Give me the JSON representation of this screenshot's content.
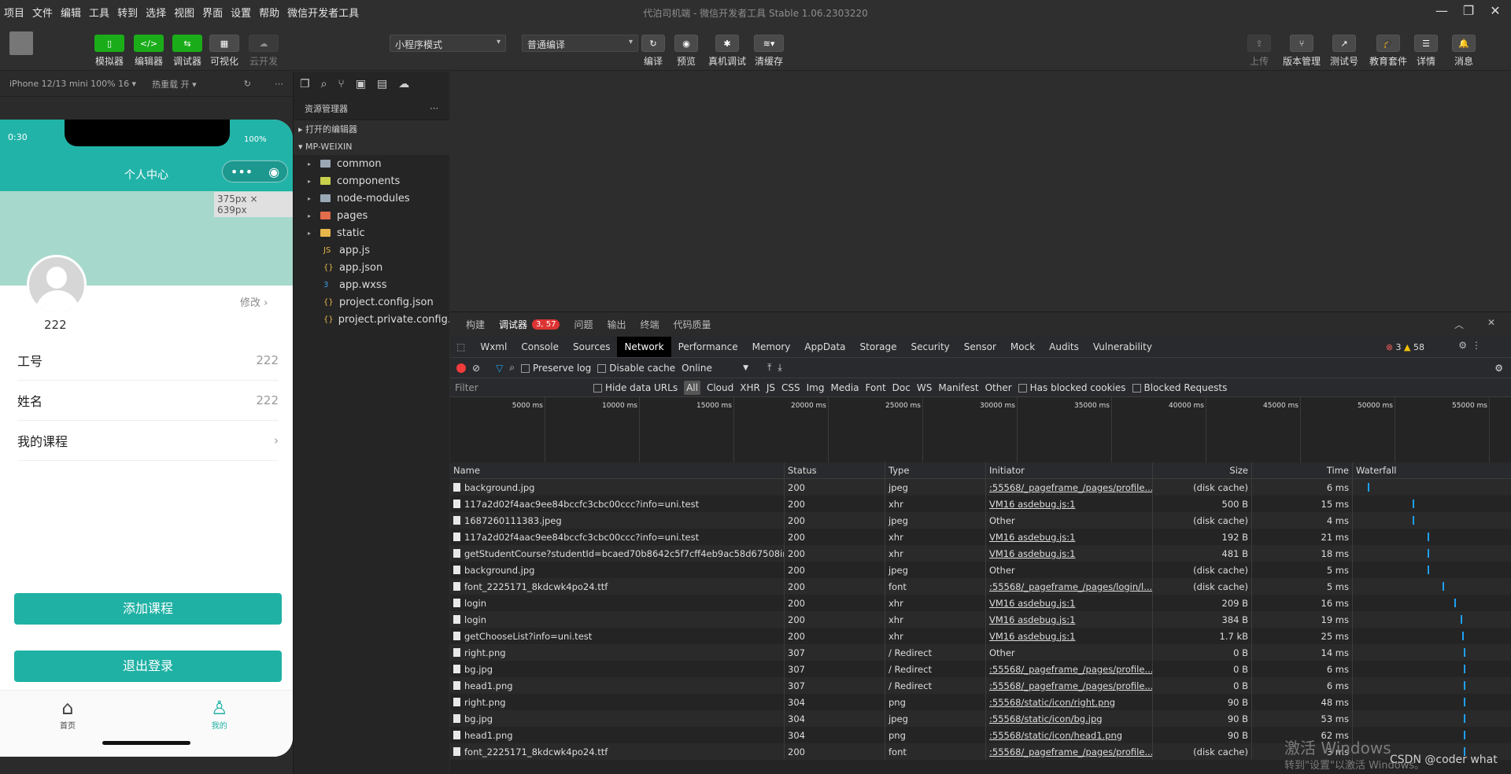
{
  "menu": [
    "项目",
    "文件",
    "编辑",
    "工具",
    "转到",
    "选择",
    "视图",
    "界面",
    "设置",
    "帮助",
    "微信开发者工具"
  ],
  "window_title": "代泊司机端 - 微信开发者工具 Stable 1.06.2303220",
  "toolbar": {
    "left": [
      "模拟器",
      "编辑器",
      "调试器",
      "可视化",
      "云开发"
    ],
    "mode": "小程序模式",
    "compile": "普通编译",
    "mid": [
      "编译",
      "预览",
      "真机调试",
      "清缓存"
    ],
    "right": [
      "上传",
      "版本管理",
      "测试号",
      "教育套件",
      "详情",
      "消息"
    ]
  },
  "sim": {
    "device": "iPhone 12/13 mini 100% 16 ▾",
    "hot": "热重载 开 ▾",
    "time": "0:30",
    "battery": "100%",
    "nav_title": "个人中心",
    "dim": "375px × 639px",
    "username": "222",
    "edit": "修改",
    "rows": [
      {
        "label": "工号",
        "value": "222"
      },
      {
        "label": "姓名",
        "value": "222"
      },
      {
        "label": "我的课程",
        "value": "›"
      }
    ],
    "btn_add": "添加课程",
    "btn_logout": "退出登录",
    "tab_home": "首页",
    "tab_me": "我的"
  },
  "explorer": {
    "title": "资源管理器",
    "open_editors": "打开的编辑器",
    "project": "MP-WEIXIN",
    "items": [
      {
        "name": "common",
        "type": "folder",
        "color": "#9aa7b5"
      },
      {
        "name": "components",
        "type": "folder",
        "color": "#c9d24a"
      },
      {
        "name": "node-modules",
        "type": "folder",
        "color": "#9aa7b5"
      },
      {
        "name": "pages",
        "type": "folder",
        "color": "#e26d4d"
      },
      {
        "name": "static",
        "type": "folder",
        "color": "#e8b74c"
      },
      {
        "name": "app.js",
        "type": "file",
        "icon": "JS"
      },
      {
        "name": "app.json",
        "type": "file",
        "icon": "{}"
      },
      {
        "name": "app.wxss",
        "type": "file",
        "icon": "3"
      },
      {
        "name": "project.config.json",
        "type": "file",
        "icon": "{}"
      },
      {
        "name": "project.private.config.js...",
        "type": "file",
        "icon": "{}"
      }
    ]
  },
  "devtools": {
    "tabs1": [
      "构建",
      "调试器",
      "问题",
      "输出",
      "终端",
      "代码质量"
    ],
    "badge": "3, 57",
    "tabs2": [
      "Wxml",
      "Console",
      "Sources",
      "Network",
      "Performance",
      "Memory",
      "AppData",
      "Storage",
      "Security",
      "Sensor",
      "Mock",
      "Audits",
      "Vulnerability"
    ],
    "errors": "3",
    "warnings": "58",
    "netbar": {
      "preserve": "Preserve log",
      "disable": "Disable cache",
      "online": "Online"
    },
    "filter": {
      "placeholder": "Filter",
      "hide": "Hide data URLs",
      "types": [
        "All",
        "Cloud",
        "XHR",
        "JS",
        "CSS",
        "Img",
        "Media",
        "Font",
        "Doc",
        "WS",
        "Manifest",
        "Other"
      ],
      "blocked_cookies": "Has blocked cookies",
      "blocked_req": "Blocked Requests"
    },
    "timeline": [
      "5000 ms",
      "10000 ms",
      "15000 ms",
      "20000 ms",
      "25000 ms",
      "30000 ms",
      "35000 ms",
      "40000 ms",
      "45000 ms",
      "50000 ms",
      "55000 ms"
    ],
    "columns": [
      "Name",
      "Status",
      "Type",
      "Initiator",
      "Size",
      "Time",
      "Waterfall"
    ],
    "rows": [
      {
        "name": "background.jpg",
        "status": "200",
        "type": "jpeg",
        "init": ":55568/_pageframe_/pages/profile...",
        "size": "(disk cache)",
        "time": "6 ms",
        "w": 0.1
      },
      {
        "name": "117a2d02f4aac9ee84bccfc3cbc00ccc?info=uni.test",
        "status": "200",
        "type": "xhr",
        "init": "VM16 asdebug.js:1",
        "size": "500 B",
        "time": "15 ms",
        "w": 0.4
      },
      {
        "name": "1687260111383.jpeg",
        "status": "200",
        "type": "jpeg",
        "init": "Other",
        "size": "(disk cache)",
        "time": "4 ms",
        "w": 0.4
      },
      {
        "name": "117a2d02f4aac9ee84bccfc3cbc00ccc?info=uni.test",
        "status": "200",
        "type": "xhr",
        "init": "VM16 asdebug.js:1",
        "size": "192 B",
        "time": "21 ms",
        "w": 0.5
      },
      {
        "name": "getStudentCourse?studentId=bcaed70b8642c5f7cff4eb9ac58d67508info...",
        "status": "200",
        "type": "xhr",
        "init": "VM16 asdebug.js:1",
        "size": "481 B",
        "time": "18 ms",
        "w": 0.5
      },
      {
        "name": "background.jpg",
        "status": "200",
        "type": "jpeg",
        "init": "Other",
        "size": "(disk cache)",
        "time": "5 ms",
        "w": 0.5
      },
      {
        "name": "font_2225171_8kdcwk4po24.ttf",
        "status": "200",
        "type": "font",
        "init": ":55568/_pageframe_/pages/login/l...",
        "size": "(disk cache)",
        "time": "5 ms",
        "w": 0.6
      },
      {
        "name": "login",
        "status": "200",
        "type": "xhr",
        "init": "VM16 asdebug.js:1",
        "size": "209 B",
        "time": "16 ms",
        "w": 0.68
      },
      {
        "name": "login",
        "status": "200",
        "type": "xhr",
        "init": "VM16 asdebug.js:1",
        "size": "384 B",
        "time": "19 ms",
        "w": 0.72
      },
      {
        "name": "getChooseList?info=uni.test",
        "status": "200",
        "type": "xhr",
        "init": "VM16 asdebug.js:1",
        "size": "1.7 kB",
        "time": "25 ms",
        "w": 0.73
      },
      {
        "name": "right.png",
        "status": "307",
        "type": "/ Redirect",
        "init": "Other",
        "size": "0 B",
        "time": "14 ms",
        "w": 0.74
      },
      {
        "name": "bg.jpg",
        "status": "307",
        "type": "/ Redirect",
        "init": ":55568/_pageframe_/pages/profile...",
        "size": "0 B",
        "time": "6 ms",
        "w": 0.74
      },
      {
        "name": "head1.png",
        "status": "307",
        "type": "/ Redirect",
        "init": ":55568/_pageframe_/pages/profile...",
        "size": "0 B",
        "time": "6 ms",
        "w": 0.74
      },
      {
        "name": "right.png",
        "status": "304",
        "type": "png",
        "init": ":55568/static/icon/right.png",
        "size": "90 B",
        "time": "48 ms",
        "w": 0.74
      },
      {
        "name": "bg.jpg",
        "status": "304",
        "type": "jpeg",
        "init": ":55568/static/icon/bg.jpg",
        "size": "90 B",
        "time": "53 ms",
        "w": 0.74
      },
      {
        "name": "head1.png",
        "status": "304",
        "type": "png",
        "init": ":55568/static/icon/head1.png",
        "size": "90 B",
        "time": "62 ms",
        "w": 0.74
      },
      {
        "name": "font_2225171_8kdcwk4po24.ttf",
        "status": "200",
        "type": "font",
        "init": ":55568/_pageframe_/pages/profile...",
        "size": "(disk cache)",
        "time": "3 ms",
        "w": 0.74
      }
    ]
  },
  "watermark": "激活 Windows",
  "watermark2": "转到\"设置\"以激活 Windows。",
  "csdn": "CSDN @coder what"
}
